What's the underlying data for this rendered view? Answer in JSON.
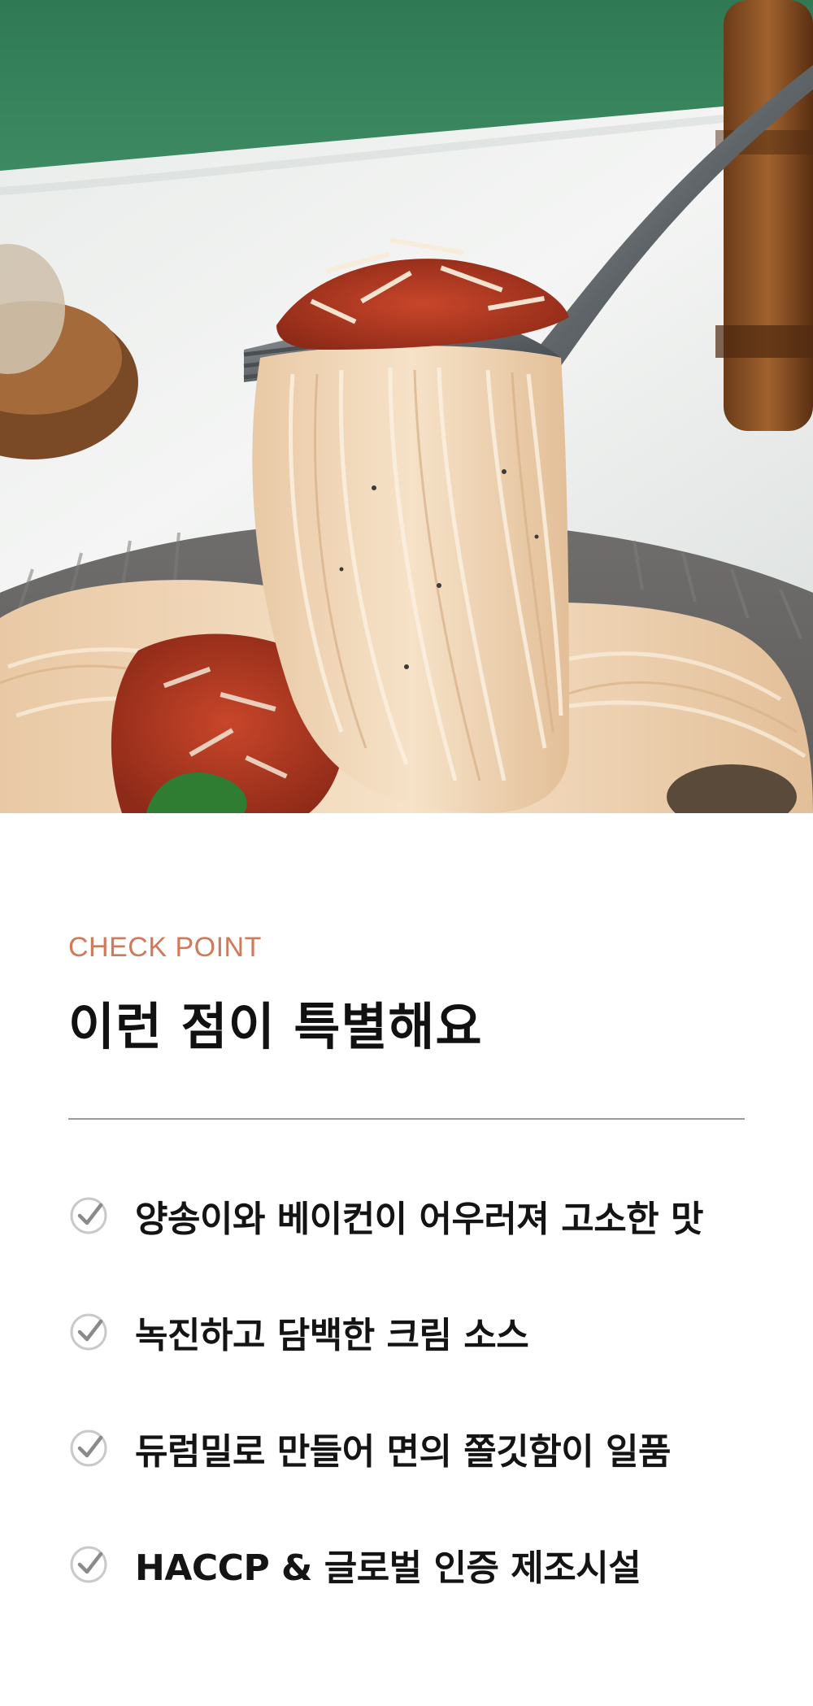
{
  "hero": {
    "icon": "pasta-fork-photo"
  },
  "section": {
    "eyebrow": "CHECK POINT",
    "title": "이런 점이 특별해요",
    "accent_color": "#d07a5c"
  },
  "features": [
    {
      "label": "양송이와 베이컨이 어우러져 고소한 맛",
      "icon": "check-circle-icon"
    },
    {
      "label": "녹진하고 담백한 크림 소스",
      "icon": "check-circle-icon"
    },
    {
      "label": "듀럼밀로 만들어 면의 쫄깃함이 일품",
      "icon": "check-circle-icon"
    },
    {
      "label": "HACCP & 글로벌 인증 제조시설",
      "icon": "check-circle-icon"
    }
  ]
}
